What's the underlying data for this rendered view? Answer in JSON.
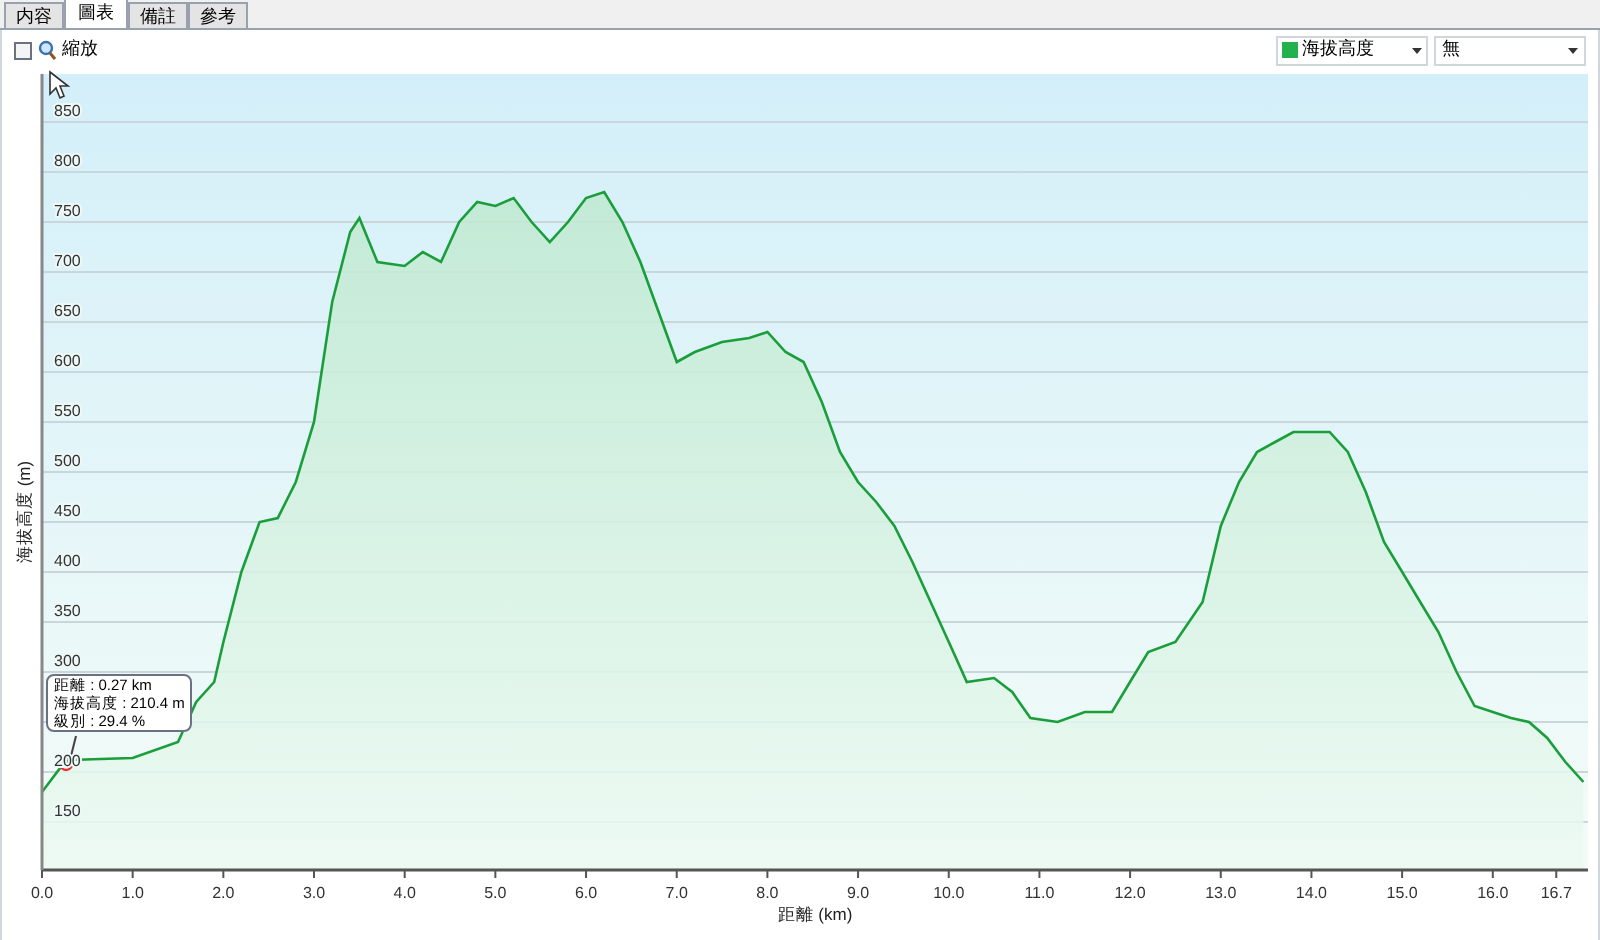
{
  "tabs": [
    {
      "label": "内容",
      "selected": false
    },
    {
      "label": "圖表",
      "selected": true
    },
    {
      "label": "備註",
      "selected": false
    },
    {
      "label": "參考",
      "selected": false
    }
  ],
  "toolbar": {
    "zoom_checkbox": {
      "label": "縮放",
      "checked": false
    },
    "series_dropdown": {
      "color": "#22b14c"
    },
    "second_dropdown": {
      "value": "無"
    }
  },
  "chart": {
    "chart_data": {
      "type": "area",
      "grid": true,
      "xlabel": "距離 (km)",
      "ylabel": "海拔高度 (m)",
      "xlim": [
        0,
        17.05
      ],
      "ylim": [
        102,
        898
      ],
      "xticks": [
        {
          "value": 0,
          "label": "0.0"
        },
        {
          "value": 1,
          "label": "1.0"
        },
        {
          "value": 2,
          "label": "2.0"
        },
        {
          "value": 3,
          "label": "3.0"
        },
        {
          "value": 4,
          "label": "4.0"
        },
        {
          "value": 5,
          "label": "5.0"
        },
        {
          "value": 6,
          "label": "6.0"
        },
        {
          "value": 7,
          "label": "7.0"
        },
        {
          "value": 8,
          "label": "8.0"
        },
        {
          "value": 9,
          "label": "9.0"
        },
        {
          "value": 10,
          "label": "10.0"
        },
        {
          "value": 11,
          "label": "11.0"
        },
        {
          "value": 12,
          "label": "12.0"
        },
        {
          "value": 13,
          "label": "13.0"
        },
        {
          "value": 14,
          "label": "14.0"
        },
        {
          "value": 15,
          "label": "15.0"
        },
        {
          "value": 16,
          "label": "16.0"
        },
        {
          "value": 16.7,
          "label": "16.7"
        }
      ],
      "yticks": [
        150,
        200,
        300,
        350,
        400,
        450,
        500,
        550,
        600,
        650,
        700,
        750,
        800,
        850
      ],
      "x": [
        0,
        0.2,
        0.3,
        1.0,
        1.5,
        1.7,
        1.9,
        2.0,
        2.2,
        2.4,
        2.6,
        2.8,
        3.0,
        3.2,
        3.4,
        3.5,
        3.7,
        4.0,
        4.2,
        4.4,
        4.6,
        4.8,
        5.0,
        5.2,
        5.4,
        5.6,
        5.8,
        6.0,
        6.2,
        6.4,
        6.6,
        6.8,
        7.0,
        7.2,
        7.5,
        7.8,
        8.0,
        8.2,
        8.4,
        8.6,
        8.8,
        9.0,
        9.2,
        9.4,
        9.6,
        9.8,
        10.0,
        10.2,
        10.5,
        10.7,
        10.9,
        11.2,
        11.5,
        11.8,
        12.0,
        12.2,
        12.5,
        12.8,
        13.0,
        13.2,
        13.4,
        13.6,
        13.8,
        14.0,
        14.2,
        14.4,
        14.6,
        14.8,
        15.0,
        15.2,
        15.4,
        15.6,
        15.8,
        16.0,
        16.2,
        16.4,
        16.6,
        16.8,
        17.0
      ],
      "series": [
        {
          "name": "海拔高度",
          "color": "#1a9e3c",
          "values": [
            180,
            204,
            212,
            214,
            230,
            270,
            290,
            330,
            400,
            450,
            454,
            490,
            550,
            670,
            740,
            754,
            710,
            706,
            720,
            710,
            750,
            770,
            766,
            774,
            750,
            730,
            750,
            774,
            780,
            750,
            710,
            660,
            610,
            620,
            630,
            634,
            640,
            620,
            610,
            570,
            520,
            490,
            470,
            446,
            410,
            370,
            330,
            290,
            294,
            280,
            254,
            250,
            260,
            260,
            290,
            320,
            330,
            370,
            446,
            490,
            520,
            530,
            540,
            540,
            540,
            520,
            480,
            430,
            400,
            370,
            340,
            300,
            266,
            260,
            254,
            250,
            234,
            210,
            190
          ]
        }
      ]
    },
    "tooltip": {
      "lines": [
        "距離 : 0.27 km",
        "海拔高度 : 210.4 m",
        "級別 : 29.4 %"
      ]
    }
  }
}
